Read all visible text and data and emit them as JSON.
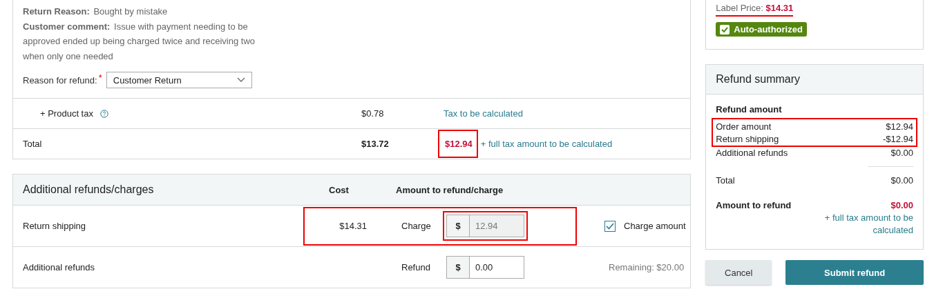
{
  "order_details": {
    "fields": [
      {
        "label": "Return Reason:",
        "value": "Bought by mistake"
      },
      {
        "label": "Customer comment:",
        "value": "Issue with payment needing to be approved ended up being charged twice and receiving two when only one needed"
      }
    ],
    "reason_field": {
      "label": "Reason for refund:",
      "required_mark": "*",
      "value": "Customer Return"
    }
  },
  "price_table": {
    "rows": [
      {
        "kind": "tax",
        "label": "+ Product tax",
        "amount": "$0.78",
        "note": "Tax to be calculated"
      },
      {
        "kind": "total",
        "label": "Total",
        "amount": "$13.72",
        "refund": "$12.94",
        "note": "+ full tax amount to be calculated",
        "highlighted": true
      }
    ]
  },
  "additional": {
    "title": "Additional refunds/charges",
    "columns": [
      "Cost",
      "Amount to refund/charge"
    ],
    "rows": [
      {
        "label": "Return shipping",
        "cost": "$14.31",
        "action": "Charge",
        "currency": "$",
        "value": "12.94",
        "disabled": true,
        "highlighted": true,
        "checkbox": {
          "label": "Charge amount",
          "checked": true
        }
      },
      {
        "label": "Additional refunds",
        "action": "Refund",
        "currency": "$",
        "value": "0.00",
        "disabled": false,
        "highlighted": false,
        "remaining": "Remaining: $20.00"
      }
    ]
  },
  "label_info": {
    "label": "Label Price:",
    "price": "$14.31",
    "underlined": true,
    "badge": "Auto-authorized"
  },
  "summary": {
    "title": "Refund summary",
    "heading": "Refund amount",
    "lines": [
      {
        "label": "Order amount",
        "value": "$12.94",
        "highlighted": true
      },
      {
        "label": "Return shipping",
        "value": "-$12.94",
        "highlighted": true
      },
      {
        "label": "Additional refunds",
        "value": "$0.00",
        "highlighted": false
      }
    ],
    "total": {
      "label": "Total",
      "value": "$0.00"
    },
    "refund": {
      "label": "Amount to refund",
      "value": "$0.00",
      "note": "+ full tax amount to be calculated"
    }
  },
  "buttons": [
    {
      "label": "Cancel",
      "kind": "secondary"
    },
    {
      "label": "Submit refund",
      "kind": "primary"
    }
  ]
}
